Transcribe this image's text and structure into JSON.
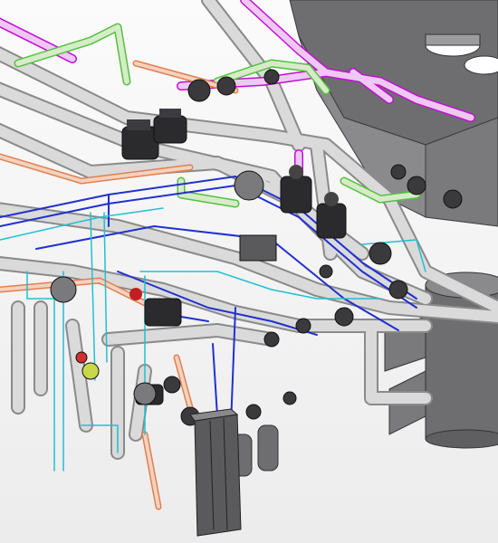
{
  "viewport": {
    "background_top": "#fbfbfb",
    "background_bottom": "#ececec"
  },
  "scene": {
    "kind": "3d-piping-model-view",
    "systems": [
      {
        "name": "grey-main-piping",
        "color": "#d6d6d6",
        "edge": "#8a8a8a"
      },
      {
        "name": "magenta-piping",
        "color": "#e9b5ee",
        "edge": "#c010d0"
      },
      {
        "name": "green-piping",
        "color": "#cfe7c0",
        "edge": "#55c040"
      },
      {
        "name": "orange-piping",
        "color": "#ecc4ad",
        "edge": "#e08050"
      },
      {
        "name": "blue-piping",
        "color": "#d0d6f2",
        "edge": "#2030d0"
      },
      {
        "name": "cyan-piping",
        "color": "#d8f2f4",
        "edge": "#22c0d0"
      }
    ],
    "equipment": [
      {
        "name": "air-handling-unit",
        "color": "#6e6e70"
      },
      {
        "name": "storage-tank",
        "color": "#6e6e70"
      },
      {
        "name": "plate-heat-exchanger",
        "color": "#5a5a5c"
      },
      {
        "name": "expansion-vessels",
        "color": "#6e6e70"
      },
      {
        "name": "pumps",
        "color": "#2b2b2e"
      },
      {
        "name": "valves",
        "color": "#3a3a3c"
      }
    ]
  }
}
